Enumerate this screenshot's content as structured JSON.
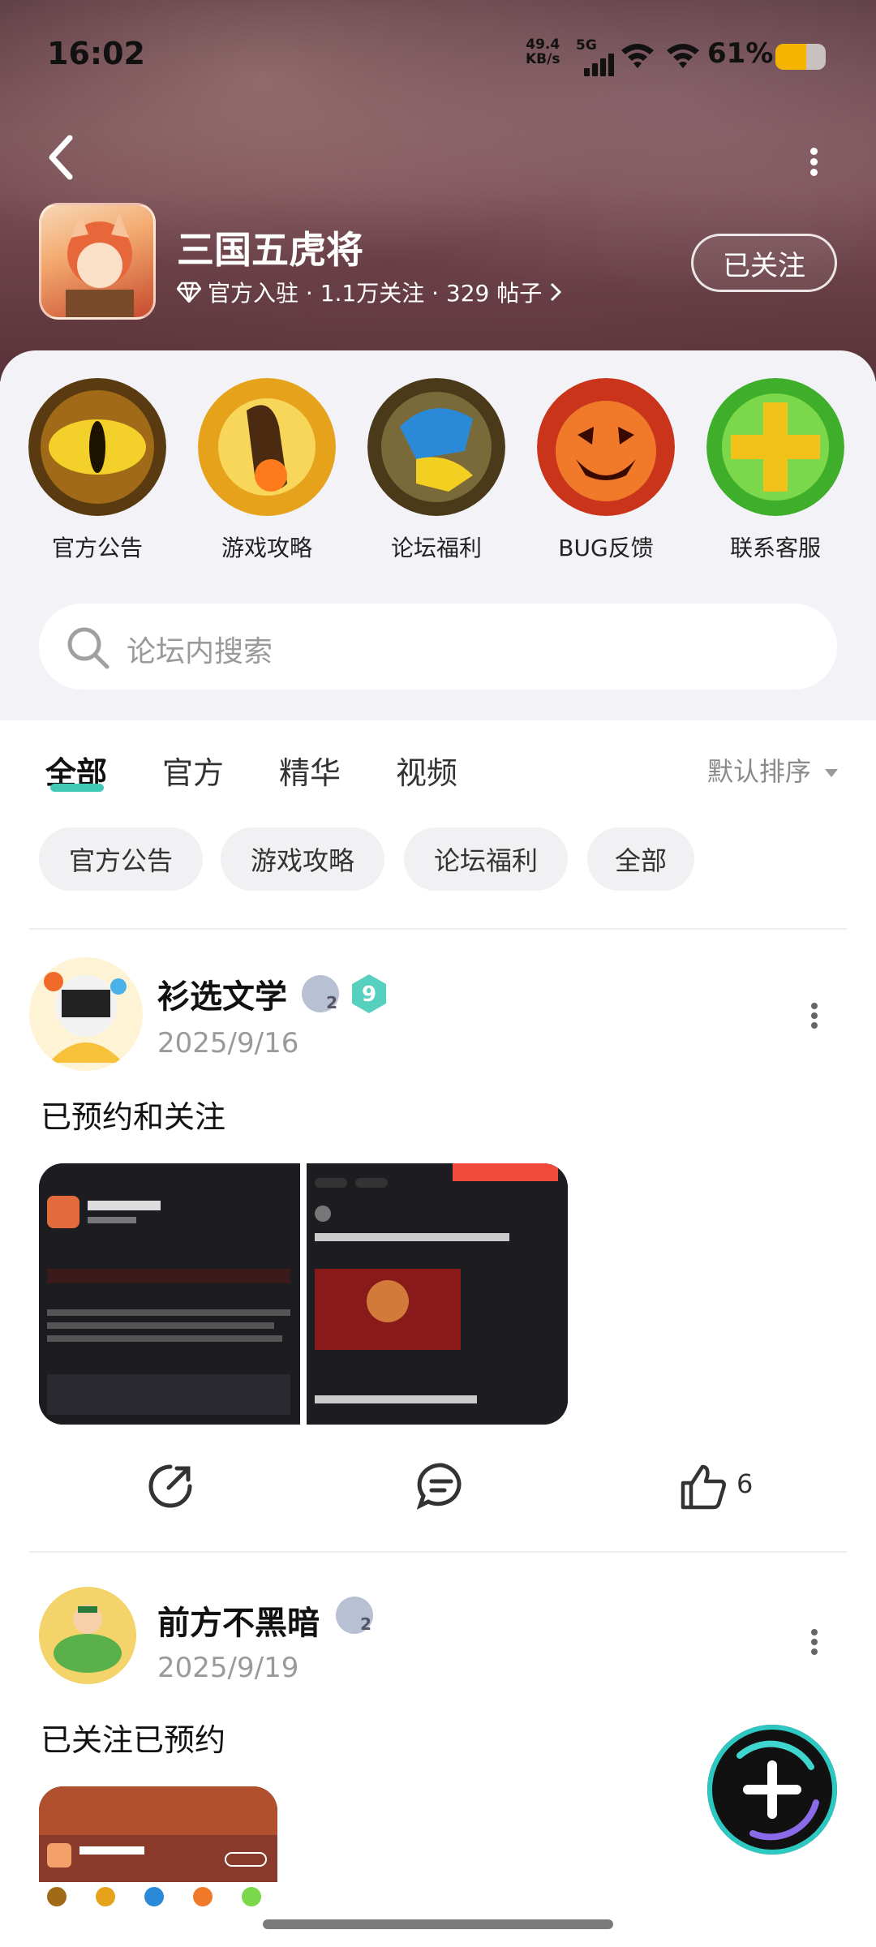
{
  "status_bar": {
    "time": "16:02",
    "net_speed_value": "49.4",
    "net_speed_unit": "KB/s",
    "network": "5G",
    "battery_text": "61%",
    "battery_level": 0.61
  },
  "header": {
    "forum_name": "三国五虎将",
    "meta": "官方入驻 · 1.1万关注 · 329 帖子",
    "follow_label": "已关注",
    "back_icon": "back-arrow-icon",
    "more_icon": "more-vertical-icon"
  },
  "categories": [
    {
      "label": "官方公告",
      "icon": "serpent-eye-icon"
    },
    {
      "label": "游戏攻略",
      "icon": "fire-hand-icon"
    },
    {
      "label": "论坛福利",
      "icon": "blue-gauntlet-icon"
    },
    {
      "label": "BUG反馈",
      "icon": "pumpkin-face-icon"
    },
    {
      "label": "联系客服",
      "icon": "green-plus-icon"
    }
  ],
  "search": {
    "placeholder": "论坛内搜索"
  },
  "tabs": [
    {
      "label": "全部",
      "active": true
    },
    {
      "label": "官方",
      "active": false
    },
    {
      "label": "精华",
      "active": false
    },
    {
      "label": "视频",
      "active": false
    }
  ],
  "sort_label": "默认排序",
  "chips": [
    "官方公告",
    "游戏攻略",
    "论坛福利",
    "全部"
  ],
  "posts": [
    {
      "username": "衫选文学",
      "level_badge": "2",
      "vip_badge": "9",
      "date": "2025/9/16",
      "text": "已预约和关注",
      "like_count": "6"
    },
    {
      "username": "前方不黑暗",
      "level_badge": "2",
      "date": "2025/9/19",
      "text": "已关注已预约"
    }
  ],
  "colors": {
    "accent": "#40c9b5",
    "chip_bg": "#f1f1f3"
  },
  "fab_icon": "plus-icon"
}
